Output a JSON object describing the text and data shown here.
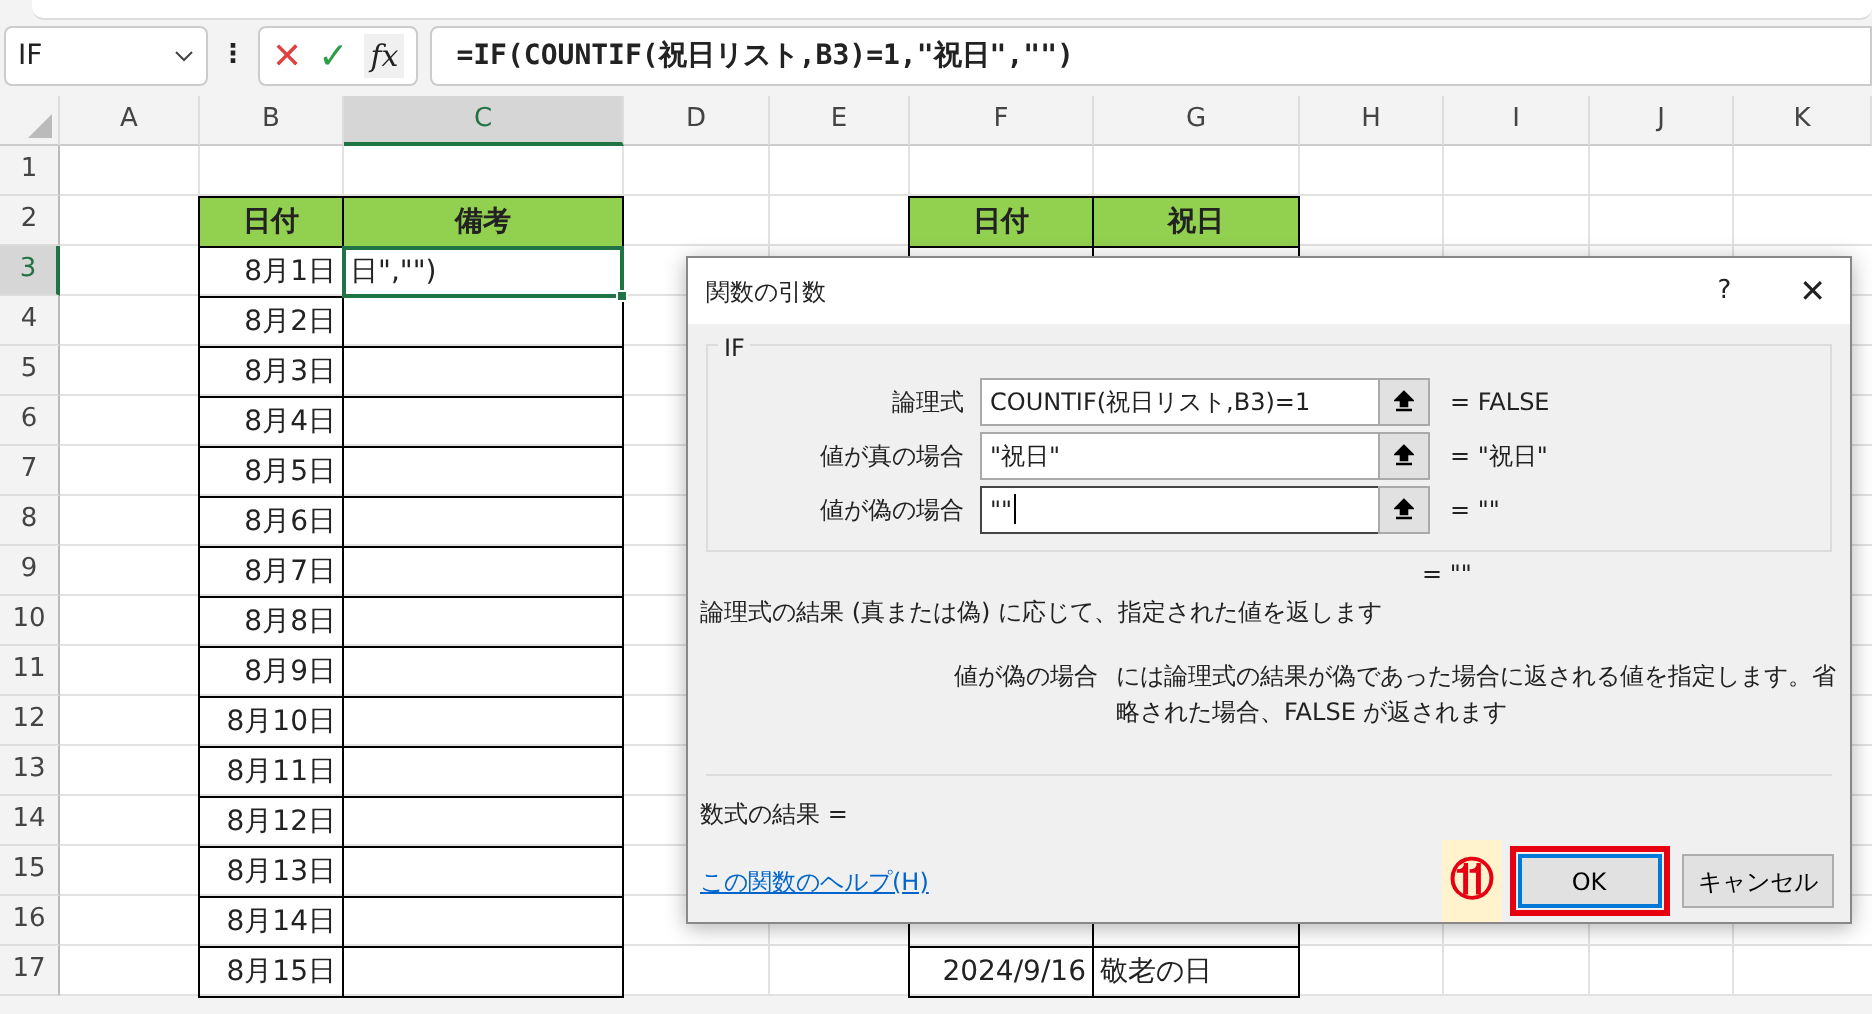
{
  "formula_bar": {
    "name_box": "IF",
    "more": "⋮",
    "cancel": "✕",
    "enter": "✓",
    "fx": "fx",
    "formula": "=IF(COUNTIF(祝日リスト,B3)=1,\"祝日\",\"\")"
  },
  "sheet": {
    "columns": [
      {
        "label": "A",
        "selected": false
      },
      {
        "label": "B",
        "selected": false
      },
      {
        "label": "C",
        "selected": true
      },
      {
        "label": "D",
        "selected": false
      },
      {
        "label": "E",
        "selected": false
      },
      {
        "label": "F",
        "selected": false
      },
      {
        "label": "G",
        "selected": false
      },
      {
        "label": "H",
        "selected": false
      },
      {
        "label": "I",
        "selected": false
      },
      {
        "label": "J",
        "selected": false
      },
      {
        "label": "K",
        "selected": false
      }
    ],
    "rows": [
      {
        "number": "1",
        "selected": false
      },
      {
        "number": "2",
        "selected": false
      },
      {
        "number": "3",
        "selected": true
      },
      {
        "number": "4",
        "selected": false
      },
      {
        "number": "5",
        "selected": false
      },
      {
        "number": "6",
        "selected": false
      },
      {
        "number": "7",
        "selected": false
      },
      {
        "number": "8",
        "selected": false
      },
      {
        "number": "9",
        "selected": false
      },
      {
        "number": "10",
        "selected": false
      },
      {
        "number": "11",
        "selected": false
      },
      {
        "number": "12",
        "selected": false
      },
      {
        "number": "13",
        "selected": false
      },
      {
        "number": "14",
        "selected": false
      },
      {
        "number": "15",
        "selected": false
      },
      {
        "number": "16",
        "selected": false
      },
      {
        "number": "17",
        "selected": false
      }
    ],
    "date_table": {
      "headers": [
        "日付",
        "備考"
      ],
      "rows": [
        {
          "date": "8月1日",
          "note": "日\",\"\")",
          "editing": true
        },
        {
          "date": "8月2日",
          "editing": false
        },
        {
          "date": "8月3日",
          "editing": false
        },
        {
          "date": "8月4日",
          "editing": false
        },
        {
          "date": "8月5日",
          "editing": false
        },
        {
          "date": "8月6日",
          "editing": false
        },
        {
          "date": "8月7日",
          "editing": false
        },
        {
          "date": "8月8日",
          "editing": false
        },
        {
          "date": "8月9日",
          "editing": false
        },
        {
          "date": "8月10日",
          "editing": false
        },
        {
          "date": "8月11日",
          "editing": false
        },
        {
          "date": "8月12日",
          "editing": false
        },
        {
          "date": "8月13日",
          "editing": false
        },
        {
          "date": "8月14日",
          "editing": false
        },
        {
          "date": "8月15日",
          "editing": false
        }
      ]
    },
    "holiday_table": {
      "headers": [
        "日付",
        "祝日"
      ],
      "visible_rows": [
        {
          "date": "2024/9/16",
          "holiday": "敬老の日"
        }
      ]
    }
  },
  "dialog": {
    "title": "関数の引数",
    "help": "?",
    "close": "✕",
    "function": "IF",
    "arguments": [
      {
        "label": "論理式",
        "value": "COUNTIF(祝日リスト,B3)=1",
        "result": "=  FALSE",
        "focused": false
      },
      {
        "label": "値が真の場合",
        "value": "\"祝日\"",
        "result": "=  \"祝日\"",
        "focused": false
      },
      {
        "label": "値が偽の場合",
        "value": "\"\"",
        "result": "=  \"\"",
        "focused": true
      }
    ],
    "overall_result": "=  \"\"",
    "description": "論理式の結果 (真または偽) に応じて、指定された値を返します",
    "argument_name": "値が偽の場合",
    "argument_help": "には論理式の結果が偽であった場合に返される値を指定します。省略された場合、FALSE が返されます",
    "formula_result": "数式の結果 =",
    "help_link": "この関数のヘルプ(H)",
    "step_marker": "⑪",
    "buttons": [
      {
        "label": "OK",
        "kind": "default",
        "highlighted": true
      },
      {
        "label": "キャンセル",
        "kind": "normal",
        "highlighted": false
      }
    ]
  }
}
